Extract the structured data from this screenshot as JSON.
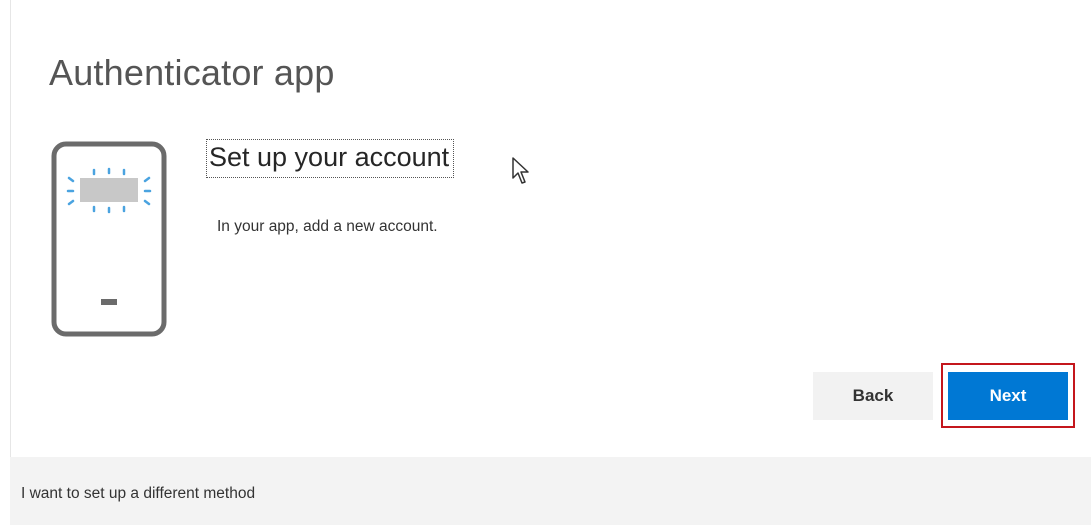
{
  "page": {
    "title": "Authenticator app",
    "subtitle": "Set up your account",
    "description": "In your app, add a new account."
  },
  "buttons": {
    "back_label": "Back",
    "next_label": "Next"
  },
  "footer": {
    "alt_method_link": "I want to set up a different method"
  },
  "icons": {
    "illustration": "phone-qr-icon",
    "pointer": "mouse-cursor-icon"
  },
  "colors": {
    "primary": "#0078d4",
    "highlight_border": "#c4161c",
    "footer_bg": "#f3f3f3",
    "back_bg": "#f2f2f2"
  }
}
